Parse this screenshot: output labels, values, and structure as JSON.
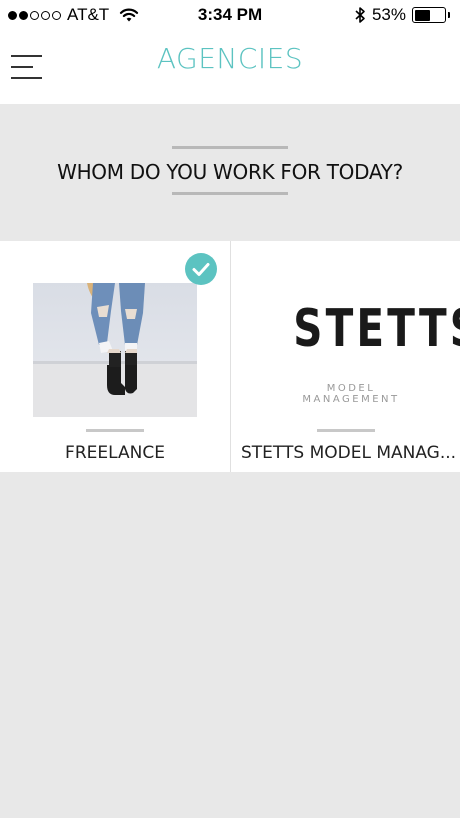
{
  "status_bar": {
    "signal_dots": [
      true,
      true,
      false,
      false,
      false
    ],
    "carrier": "AT&T",
    "time": "3:34 PM",
    "battery_percent": "53%",
    "battery_level": 0.53,
    "icons": [
      "wifi-icon",
      "bluetooth-icon",
      "battery-icon"
    ]
  },
  "nav": {
    "title": "AGENCIES",
    "menu_icon": "hamburger-menu-icon"
  },
  "prompt": {
    "text": "WHOM DO YOU WORK FOR TODAY?"
  },
  "agencies": [
    {
      "label": "FREELANCE",
      "selected": true
    },
    {
      "label": "STETTS MODEL MANAG...",
      "selected": false,
      "logo_text": "STETTS",
      "logo_subtext": "MODEL MANAGEMENT"
    }
  ],
  "colors": {
    "accent": "#5cc3c1",
    "background": "#e8e8e8",
    "card": "#ffffff"
  }
}
